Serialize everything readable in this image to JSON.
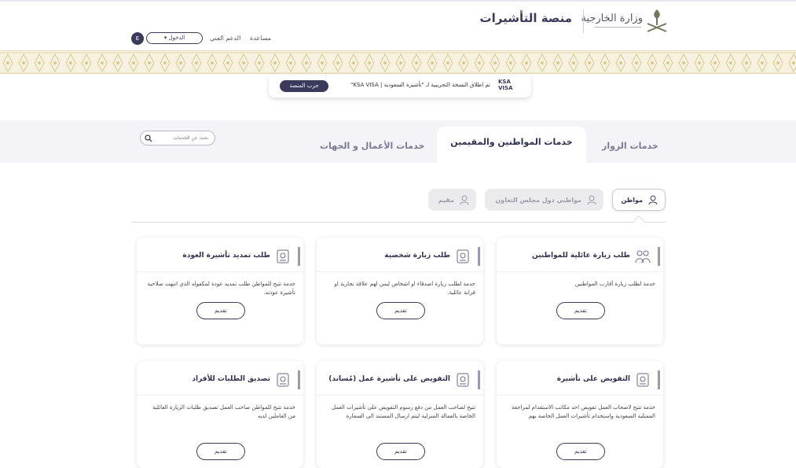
{
  "header": {
    "platform_title": "منصة التأشيرات",
    "ministry_name": "وزارة الخارجية",
    "nav": {
      "help": "مساعدة",
      "support": "الدعم الفني",
      "login": "الدخول ▾",
      "lang": "E"
    }
  },
  "announcement": {
    "logo_line1": "KSA",
    "logo_line2": "VISA",
    "text": "تم اطلاق النسخة التجريبية لـ \"تأشيرة السعودية | KSA VISA\"",
    "button": "جرب المنصة"
  },
  "tabs": [
    {
      "label": "خدمات الزوار",
      "active": false
    },
    {
      "label": "خدمات المواطنين والمقيمين",
      "active": true
    },
    {
      "label": "خدمات الأعمال و الجهات",
      "active": false
    }
  ],
  "search": {
    "placeholder": "بحث عن الخدمات"
  },
  "categories": [
    {
      "label": "مواطن",
      "active": true
    },
    {
      "label": "مواطني دول مجلس التعاون",
      "active": false
    },
    {
      "label": "مقيم",
      "active": false
    }
  ],
  "cards": [
    {
      "title": "طلب زيارة عائلية للمواطنين",
      "desc": "خدمة لطلب زيارة أقارب المواطنين",
      "button": "تقديم",
      "icon": "family-icon"
    },
    {
      "title": "طلب زيارة شخصية",
      "desc": "خدمة لطلب زيارة اصدقاء او اشخاص ليس لهم علاقة تجارية او قرابة عائلية.",
      "button": "تقديم",
      "icon": "passport-icon"
    },
    {
      "title": "طلب تمديد تأشيرة العودة",
      "desc": "خدمة تتيح للمواطن طلب تمديد عودة لمكفوله الذي انتهت صلاحية تأشيرة عودته.",
      "button": "تقديم",
      "icon": "passport-icon"
    },
    {
      "title": "التفويض على تأشيرة",
      "desc": "خدمة تتيح لاصحاب العمل تفويض احد مكاتب الاستقدام لمراجعة الممثلية السعودية واستخدام تأشيرات العمل الخاصة بهم",
      "button": "تقديم",
      "icon": "passport-icon"
    },
    {
      "title": "التفويض على تأشيرة عمل (مُساند)",
      "desc": "تتيح لصاحب العمل من دفع رسوم التفويض على تأشيرات العمل الخاصة بالعمالة المنزلية ليتم ارسال المستند الى السفارة",
      "button": "تقديم",
      "icon": "passport-icon"
    },
    {
      "title": "تصديق الطلبات للأفراد",
      "desc": "خدمة تتيح للمواطن صاحب العمل تصديق طلبات الزيارة العائلية من العاملين لديه",
      "button": "تقديم",
      "icon": "passport-icon"
    }
  ],
  "colors": {
    "primary": "#3a3a5c",
    "accent_bar": "#9a9ab8",
    "pattern_bg": "#f7f1df",
    "pattern_line": "#d9c98f"
  }
}
